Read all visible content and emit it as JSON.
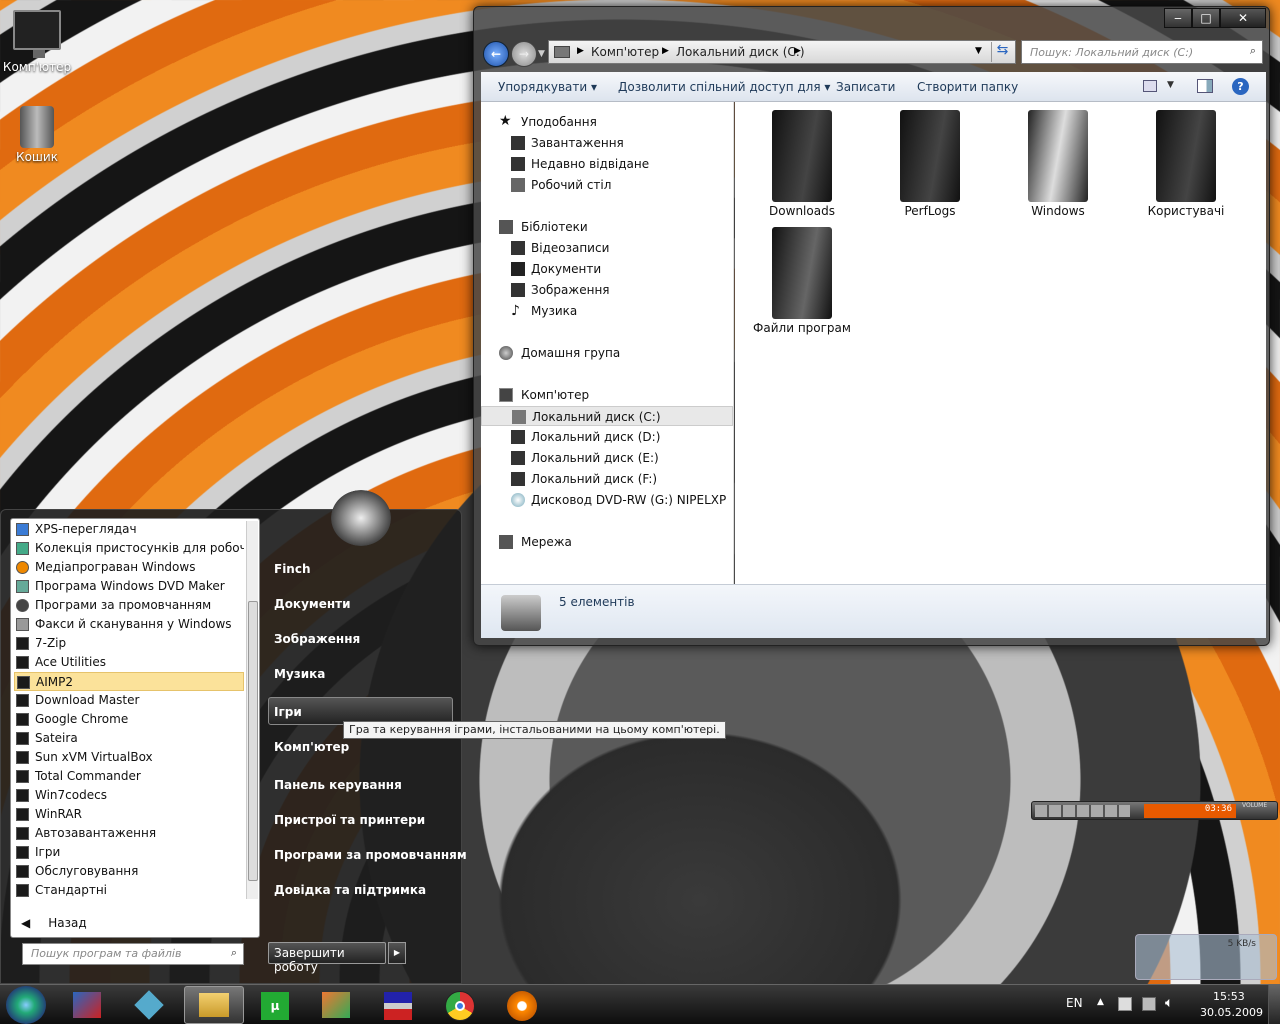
{
  "desktop": {
    "icons": [
      {
        "label": "Комп'ютер"
      },
      {
        "label": "Кошик"
      }
    ]
  },
  "explorer": {
    "breadcrumb": [
      "Комп'ютер",
      "Локальний диск (C:)"
    ],
    "search_placeholder": "Пошук: Локальний диск (C:)",
    "toolbar": [
      "Упорядкувати",
      "Дозволити спільний доступ для",
      "Записати",
      "Створити папку"
    ],
    "nav": {
      "favorites": {
        "label": "Уподобання",
        "items": [
          "Завантаження",
          "Недавно відвідане",
          "Робочий стіл"
        ]
      },
      "libraries": {
        "label": "Бібліотеки",
        "items": [
          "Відеозаписи",
          "Документи",
          "Зображення",
          "Музика"
        ]
      },
      "homegroup": "Домашня група",
      "computer": {
        "label": "Комп'ютер",
        "items": [
          "Локальний диск (C:)",
          "Локальний диск (D:)",
          "Локальний диск (E:)",
          "Локальний диск (F:)",
          "Дисковод DVD-RW (G:) NIPELXP"
        ]
      },
      "network": "Мережа"
    },
    "folders": [
      "Downloads",
      "PerfLogs",
      "Windows",
      "Користувачі",
      "Файли програм"
    ],
    "status": "5 елементів"
  },
  "startmenu": {
    "programs": [
      "XPS-переглядач",
      "Колекція пристосунків для робочого с",
      "Медіапрограван Windows",
      "Програма Windows DVD Maker",
      "Програми за промовчанням",
      "Факси й сканування у Windows",
      "7-Zip",
      "Ace Utilities",
      "AIMP2",
      "Download Master",
      "Google Chrome",
      "Sateira",
      "Sun xVM VirtualBox",
      "Total Commander",
      "Win7codecs",
      "WinRAR",
      "Автозавантаження",
      "Ігри",
      "Обслуговування",
      "Стандартні"
    ],
    "selected_program": "AIMP2",
    "back": "Назад",
    "search_placeholder": "Пошук програм та файлів",
    "right": [
      "Finch",
      "Документи",
      "Зображення",
      "Музика",
      "Ігри",
      "Комп'ютер",
      "Панель керування",
      "Пристрої та принтери",
      "Програми за промовчанням",
      "Довідка та підтримка"
    ],
    "highlighted": "Ігри",
    "tooltip": "Гра та керування іграми, інстальованими на цьому комп'ютері.",
    "shutdown": "Завершити роботу"
  },
  "player": {
    "time": "03:36",
    "volume_label": "VOLUME"
  },
  "netmeter": {
    "speed": "5 KB/s"
  },
  "tray": {
    "lang": "EN",
    "time": "15:53",
    "date": "30.05.2009"
  }
}
